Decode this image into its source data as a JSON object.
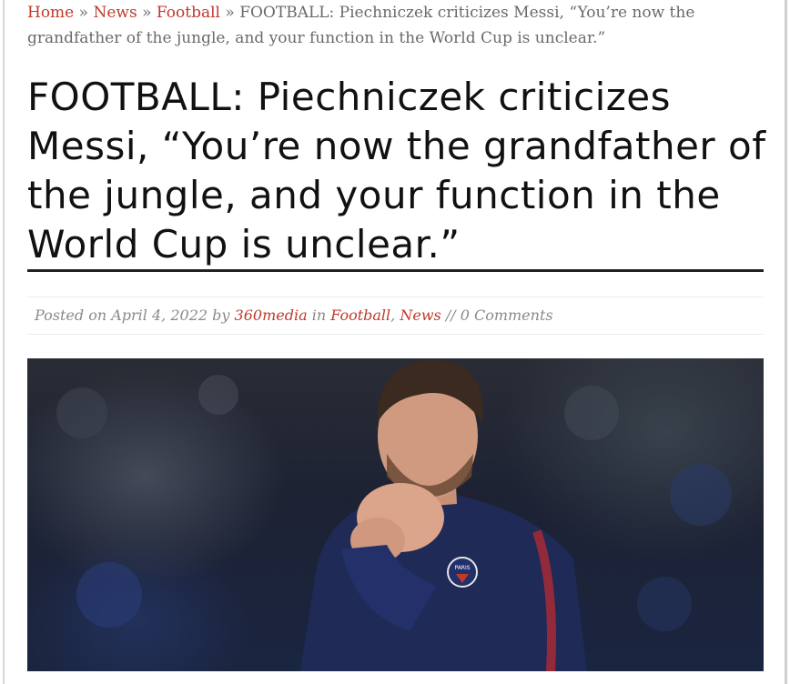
{
  "breadcrumb": {
    "home": "Home",
    "news": "News",
    "football": "Football",
    "separator": "»",
    "current": "FOOTBALL: Piechniczek criticizes Messi, “You’re now the grandfather of the jungle, and your function in the World Cup is unclear.”"
  },
  "article": {
    "title": "FOOTBALL: Piechniczek criticizes Messi, “You’re now the grandfather of the jungle, and your function in the World Cup is unclear.”",
    "meta": {
      "posted_on": "Posted on",
      "date": "April 4, 2022",
      "by": "by",
      "author": "360media",
      "in": "in",
      "category1": "Football",
      "comma": ",",
      "category2": "News",
      "divider": "//",
      "comments": "0 Comments"
    },
    "image": {
      "crest_text": "PARIS"
    }
  },
  "colors": {
    "link": "#c0392b",
    "jersey": "#1f2a57",
    "text": "#333333"
  }
}
